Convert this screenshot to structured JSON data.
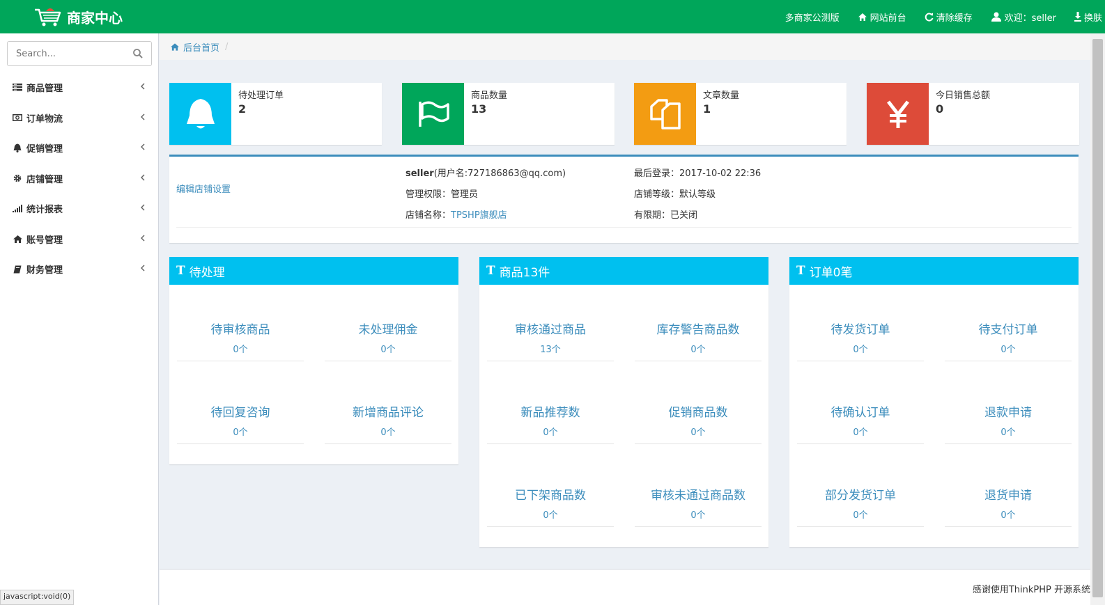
{
  "header": {
    "brand_title": "商家中心",
    "nav": [
      {
        "label": "多商家公测版",
        "icon": ""
      },
      {
        "label": "网站前台",
        "icon": "home-icon"
      },
      {
        "label": "清除缓存",
        "icon": "refresh-icon"
      },
      {
        "label": "欢迎：seller",
        "icon": "user-icon"
      },
      {
        "label": "换肤",
        "icon": "download-icon"
      }
    ]
  },
  "sidebar": {
    "search_placeholder": "Search...",
    "items": [
      {
        "label": "商品管理",
        "icon": "list-icon"
      },
      {
        "label": "订单物流",
        "icon": "money-icon"
      },
      {
        "label": "促销管理",
        "icon": "bell-icon"
      },
      {
        "label": "店铺管理",
        "icon": "gear-icon"
      },
      {
        "label": "统计报表",
        "icon": "signal-icon"
      },
      {
        "label": "账号管理",
        "icon": "home-icon"
      },
      {
        "label": "财务管理",
        "icon": "book-icon"
      }
    ]
  },
  "breadcrumb": {
    "home": "后台首页",
    "sep": "/"
  },
  "stats": [
    {
      "label": "待处理订单",
      "value": "2",
      "icon": "bell-icon",
      "color": "#00c0ef"
    },
    {
      "label": "商品数量",
      "value": "13",
      "icon": "flag-icon",
      "color": "#00a65a"
    },
    {
      "label": "文章数量",
      "value": "1",
      "icon": "copy-icon",
      "color": "#f39c12"
    },
    {
      "label": "今日销售总额",
      "value": "0",
      "icon": "yen-icon",
      "color": "#dd4b39"
    }
  ],
  "store": {
    "edit_link": "编辑店铺设置",
    "username": "seller",
    "account": "(用户名:727186863@qq.com)",
    "last_login_label": "最后登录：",
    "last_login": "2017-10-02 22:36",
    "permission_label": "管理权限：",
    "permission": "管理员",
    "level_label": "店铺等级：",
    "level": "默认等级",
    "name_label": "店铺名称：",
    "name": "TPSHP旗舰店",
    "expiry_label": "有限期：",
    "expiry": "已关闭"
  },
  "panels": [
    {
      "title": "待处理",
      "icon": "text-icon",
      "cells": [
        {
          "label": "待审核商品",
          "value": "0个"
        },
        {
          "label": "未处理佣金",
          "value": "0个"
        },
        {
          "label": "待回复咨询",
          "value": "0个"
        },
        {
          "label": "新增商品评论",
          "value": "0个"
        }
      ]
    },
    {
      "title": "商品13件",
      "icon": "text-icon",
      "cells": [
        {
          "label": "审核通过商品",
          "value": "13个"
        },
        {
          "label": "库存警告商品数",
          "value": "0个"
        },
        {
          "label": "新品推荐数",
          "value": "0个"
        },
        {
          "label": "促销商品数",
          "value": "0个"
        },
        {
          "label": "已下架商品数",
          "value": "0个"
        },
        {
          "label": "审核未通过商品数",
          "value": "0个"
        }
      ]
    },
    {
      "title": "订单0笔",
      "icon": "text-icon",
      "cells": [
        {
          "label": "待发货订单",
          "value": "0个"
        },
        {
          "label": "待支付订单",
          "value": "0个"
        },
        {
          "label": "待确认订单",
          "value": "0个"
        },
        {
          "label": "退款申请",
          "value": "0个"
        },
        {
          "label": "部分发货订单",
          "value": "0个"
        },
        {
          "label": "退货申请",
          "value": "0个"
        }
      ]
    }
  ],
  "footer": {
    "text": "感谢使用ThinkPHP 开源系统"
  },
  "statusbar": {
    "text": "javascript:void(0)"
  }
}
